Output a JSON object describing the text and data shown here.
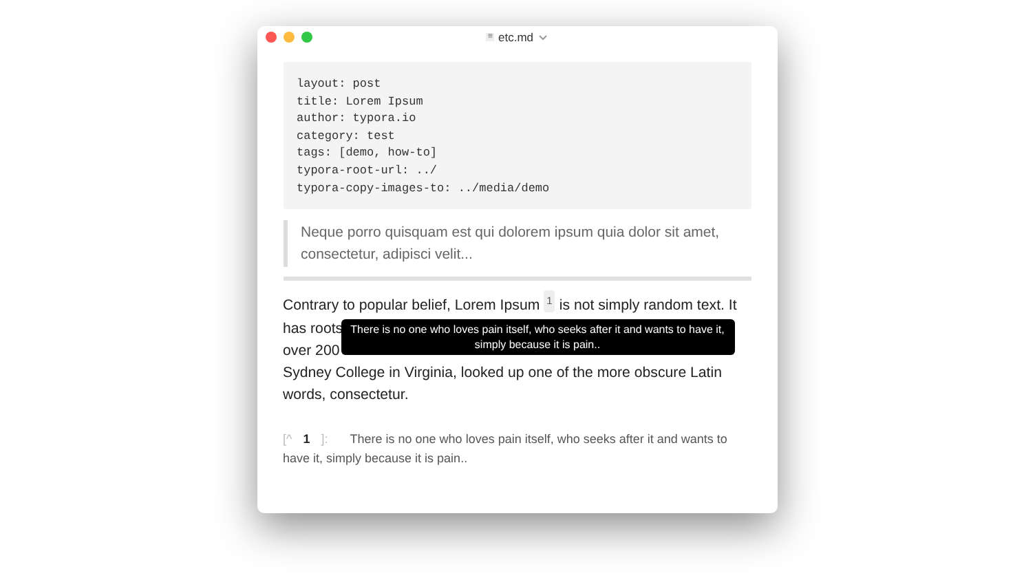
{
  "window": {
    "title": "etc.md",
    "file_icon_text": "≡"
  },
  "front_matter": [
    "layout: post",
    "title: Lorem Ipsum",
    "author: typora.io",
    "category: test",
    "tags: [demo, how-to]",
    "typora-root-url: ../",
    "typora-copy-images-to: ../media/demo"
  ],
  "blockquote": "Neque porro quisquam est qui dolorem ipsum quia dolor sit amet, consectetur, adipisci velit...",
  "paragraph": {
    "lines": [
      {
        "before": "Contrary to popular belief, Lorem Ipsum",
        "footnote_ref": "1",
        "after": "is not simply random text. It"
      },
      {
        "before": "has roots"
      },
      {
        "before": "over 200"
      },
      {
        "before": "Sydney College in Virginia, looked up one of the more obscure Latin"
      },
      {
        "before": "words, consectetur."
      }
    ]
  },
  "tooltip": "There is no one who loves pain itself, who seeks after it and wants to have it, simply because it is pain..",
  "footnote": {
    "open": "[^",
    "number": "1",
    "close": "]:",
    "text": "There is no one who loves pain itself, who seeks after it and wants to have it, simply because it is pain.."
  }
}
